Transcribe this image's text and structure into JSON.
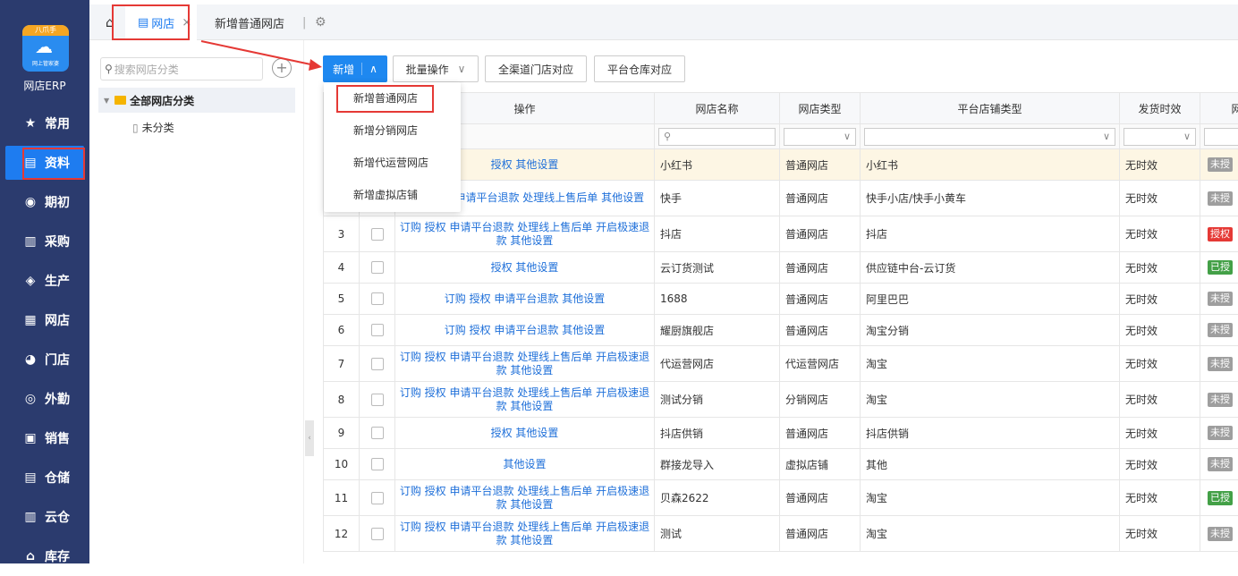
{
  "app": {
    "badge": "八爪手",
    "sub": "网上管家婆",
    "name": "网店ERP"
  },
  "menu": [
    {
      "label": "常用",
      "icon": "★"
    },
    {
      "label": "资料",
      "icon": "▤"
    },
    {
      "label": "期初",
      "icon": "◉"
    },
    {
      "label": "采购",
      "icon": "▥"
    },
    {
      "label": "生产",
      "icon": "◈"
    },
    {
      "label": "网店",
      "icon": "▦"
    },
    {
      "label": "门店",
      "icon": "◕"
    },
    {
      "label": "外勤",
      "icon": "◎"
    },
    {
      "label": "销售",
      "icon": "▣"
    },
    {
      "label": "仓储",
      "icon": "▤"
    },
    {
      "label": "云仓",
      "icon": "▥"
    },
    {
      "label": "库存",
      "icon": "⌂"
    }
  ],
  "tabs": {
    "home_icon": "home-icon",
    "tab1": "网店",
    "tab1_close": "×",
    "tab2": "新增普通网店",
    "settings_icon": "gear-icon"
  },
  "left": {
    "search_placeholder": "搜索网店分类",
    "tree_root": "全部网店分类",
    "tree_child": "未分类"
  },
  "toolbar": {
    "add": "新增",
    "add_arrow": "∧",
    "batch": "批量操作",
    "batch_arrow": "∨",
    "omni": "全渠道门店对应",
    "warehouse": "平台仓库对应"
  },
  "dropdown": [
    "新增普通网店",
    "新增分销网店",
    "新增代运营网店",
    "新增虚拟店铺"
  ],
  "columns": [
    "",
    "",
    "操作",
    "网店名称",
    "网店类型",
    "平台店铺类型",
    "发货时效",
    "网店"
  ],
  "rows": [
    {
      "n": "",
      "ops": "授权 其他设置",
      "name": "小红书",
      "type": "普通网店",
      "plat": "小红书",
      "time": "无时效",
      "badge": "未授",
      "bc": "#9e9e9e"
    },
    {
      "n": "",
      "ops": "订购 授权 申请平台退款 处理线上售后单 其他设置",
      "name": "快手",
      "type": "普通网店",
      "plat": "快手小店/快手小黄车",
      "time": "无时效",
      "badge": "未授",
      "bc": "#9e9e9e"
    },
    {
      "n": "3",
      "ops": "订购 授权 申请平台退款 处理线上售后单 开启极速退款 其他设置",
      "name": "抖店",
      "type": "普通网店",
      "plat": "抖店",
      "time": "无时效",
      "badge": "授权",
      "bc": "#e53935"
    },
    {
      "n": "4",
      "ops": "授权 其他设置",
      "name": "云订货测试",
      "type": "普通网店",
      "plat": "供应链中台-云订货",
      "time": "无时效",
      "badge": "已授",
      "bc": "#43a047"
    },
    {
      "n": "5",
      "ops": "订购 授权 申请平台退款 其他设置",
      "name": "1688",
      "type": "普通网店",
      "plat": "阿里巴巴",
      "time": "无时效",
      "badge": "未授",
      "bc": "#9e9e9e"
    },
    {
      "n": "6",
      "ops": "订购 授权 申请平台退款 其他设置",
      "name": "耀厨旗舰店",
      "type": "普通网店",
      "plat": "淘宝分销",
      "time": "无时效",
      "badge": "未授",
      "bc": "#9e9e9e"
    },
    {
      "n": "7",
      "ops": "订购 授权 申请平台退款 处理线上售后单 开启极速退款 其他设置",
      "name": "代运营网店",
      "type": "代运营网店",
      "plat": "淘宝",
      "time": "无时效",
      "badge": "未授",
      "bc": "#9e9e9e"
    },
    {
      "n": "8",
      "ops": "订购 授权 申请平台退款 处理线上售后单 开启极速退款 其他设置",
      "name": "测试分销",
      "type": "分销网店",
      "plat": "淘宝",
      "time": "无时效",
      "badge": "未授",
      "bc": "#9e9e9e"
    },
    {
      "n": "9",
      "ops": "授权 其他设置",
      "name": "抖店供销",
      "type": "普通网店",
      "plat": "抖店供销",
      "time": "无时效",
      "badge": "未授",
      "bc": "#9e9e9e"
    },
    {
      "n": "10",
      "ops": "其他设置",
      "name": "群接龙导入",
      "type": "虚拟店铺",
      "plat": "其他",
      "time": "无时效",
      "badge": "未授",
      "bc": "#9e9e9e"
    },
    {
      "n": "11",
      "ops": "订购 授权 申请平台退款 处理线上售后单 开启极速退款 其他设置",
      "name": "贝森2622",
      "type": "普通网店",
      "plat": "淘宝",
      "time": "无时效",
      "badge": "已授",
      "bc": "#43a047"
    },
    {
      "n": "12",
      "ops": "订购 授权 申请平台退款 处理线上售后单 开启极速退款 其他设置",
      "name": "测试",
      "type": "普通网店",
      "plat": "淘宝",
      "time": "无时效",
      "badge": "未授",
      "bc": "#9e9e9e"
    }
  ]
}
